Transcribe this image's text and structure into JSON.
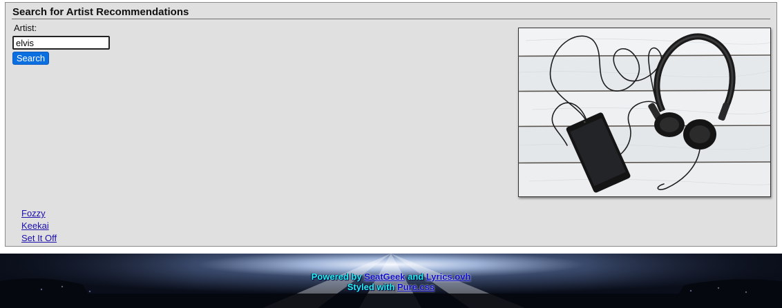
{
  "header": {
    "title": "Search for Artist Recommendations"
  },
  "search": {
    "label": "Artist:",
    "value": "elvis",
    "button_label": "Search"
  },
  "image": {
    "icon": "headphones-phone-photo"
  },
  "results": [
    "Fozzy",
    "Keekai",
    "Set It Off"
  ],
  "footer": {
    "powered_prefix": "Powered by",
    "powered_link1": "SeatGeek",
    "and_text": "and",
    "powered_link2": "Lyrics.ovh",
    "styled_prefix": "Styled with",
    "styled_link": "Pure.css"
  },
  "colors": {
    "panel_bg": "#e0e0e0",
    "button_bg": "#0c6fe0",
    "link": "#1a0dab",
    "footer_text": "#25f0f0"
  }
}
